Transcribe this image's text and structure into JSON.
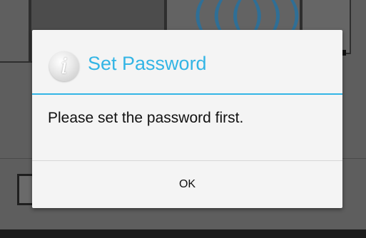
{
  "background": {
    "signal_left": "(((",
    "signal_right": ")))"
  },
  "dialog": {
    "icon": "info-icon",
    "icon_glyph": "i",
    "title": "Set Password",
    "message": "Please set the password first.",
    "ok_label": "OK"
  },
  "colors": {
    "accent": "#33b5e5",
    "dialog_bg": "#f4f4f4",
    "scrim": "#5e5e5e"
  }
}
